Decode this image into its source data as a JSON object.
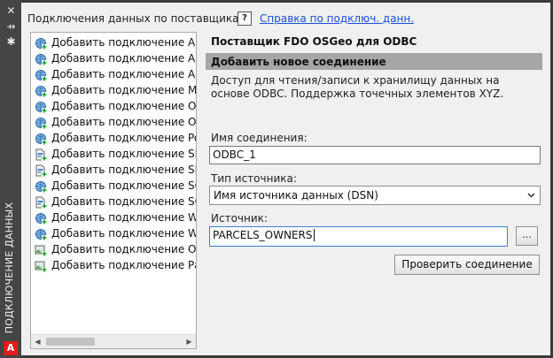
{
  "palette": {
    "vertical_title": "ПОДКЛЮЧЕНИЕ ДАННЫХ"
  },
  "list": {
    "title": "Подключения данных по поставщикам",
    "items": [
      {
        "label": "Добавить подключение ArcG",
        "icon": "globe-plus-icon"
      },
      {
        "label": "Добавить подключение ArcG",
        "icon": "globe-plus-icon"
      },
      {
        "label": "Добавить подключение ArcS",
        "icon": "globe-plus-icon"
      },
      {
        "label": "Добавить подключение MyS",
        "icon": "globe-plus-icon"
      },
      {
        "label": "Добавить подключение ODB",
        "icon": "globe-plus-icon"
      },
      {
        "label": "Добавить подключение Orac",
        "icon": "globe-plus-icon"
      },
      {
        "label": "Добавить подключение Postg",
        "icon": "globe-plus-icon"
      },
      {
        "label": "Добавить подключение SDF",
        "icon": "file-plus-icon"
      },
      {
        "label": "Добавить подключение SHP",
        "icon": "file-plus-icon"
      },
      {
        "label": "Добавить подключение SQL",
        "icon": "globe-plus-icon"
      },
      {
        "label": "Добавить подключение SQLi",
        "icon": "file-plus-icon"
      },
      {
        "label": "Добавить подключение WFS",
        "icon": "globe-plus-icon"
      },
      {
        "label": "Добавить подключение WMS",
        "icon": "globe-plus-icon"
      },
      {
        "label": "Добавить подключение Отра",
        "icon": "raster-plus-icon"
      },
      {
        "label": "Добавить подключение Раст",
        "icon": "raster-plus-icon"
      }
    ]
  },
  "help": {
    "icon_text": "?",
    "link": "Справка по подключ. данн."
  },
  "form": {
    "provider": "Поставщик FDO OSGeo для ODBC",
    "section": "Добавить новое соединение",
    "description": "Доступ для чтения/записи к хранилищу данных на основе ODBC. Поддержка точечных элементов XYZ.",
    "conn_name_label": "Имя соединения:",
    "conn_name_value": "ODBC_1",
    "source_type_label": "Тип источника:",
    "source_type_value": "Имя источника данных (DSN)",
    "source_label": "Источник:",
    "source_value": "PARCELS_OWNERS",
    "browse_label": "...",
    "test_button": "Проверить соединение"
  },
  "colors": {
    "link": "#1a4fd6",
    "section_bar": "#a6a6a6",
    "palette_bg": "#454545",
    "logo": "#e01b1b"
  }
}
